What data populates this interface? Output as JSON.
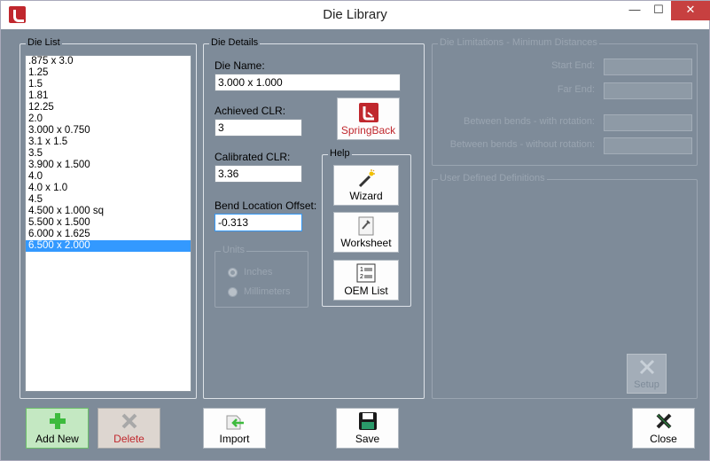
{
  "window": {
    "title": "Die Library",
    "minimize": "—",
    "maximize": "☐",
    "close": "✕"
  },
  "die_list": {
    "title": "Die List",
    "items": [
      ".875 x 3.0",
      "1.25",
      "1.5",
      "1.81",
      "12.25",
      "2.0",
      "3.000 x 0.750",
      "3.1 x 1.5",
      "3.5",
      "3.900 x 1.500",
      "4.0",
      "4.0 x 1.0",
      "4.5",
      "4.500 x 1.000 sq",
      "5.500 x 1.500",
      "6.000 x 1.625",
      "6.500 x 2.000"
    ],
    "selected_index": 16
  },
  "die_details": {
    "title": "Die Details",
    "die_name_label": "Die Name:",
    "die_name_value": "3.000 x 1.000",
    "achieved_clr_label": "Achieved CLR:",
    "achieved_clr_value": "3",
    "calibrated_clr_label": "Calibrated CLR:",
    "calibrated_clr_value": "3.36",
    "bend_offset_label": "Bend Location Offset:",
    "bend_offset_value": "-0.313",
    "springback_label": "SpringBack",
    "units": {
      "title": "Units",
      "inches": "Inches",
      "millimeters": "Millimeters",
      "selected": "Inches"
    },
    "help": {
      "title": "Help",
      "wizard": "Wizard",
      "worksheet": "Worksheet",
      "oem_list": "OEM List"
    }
  },
  "die_limitations": {
    "title": "Die Limitations - Minimum Distances",
    "start_end": "Start End:",
    "far_end": "Far End:",
    "with_rotation": "Between bends - with rotation:",
    "without_rotation": "Between bends - without rotation:"
  },
  "user_defined": {
    "title": "User Defined Definitions",
    "setup": "Setup"
  },
  "bottom": {
    "add_new": "Add New",
    "delete": "Delete",
    "import": "Import",
    "save": "Save",
    "close": "Close"
  },
  "colors": {
    "background": "#7e8b99",
    "selection": "#3399ff",
    "delete_text": "#c0272d",
    "add_green": "#3dbb3d"
  }
}
